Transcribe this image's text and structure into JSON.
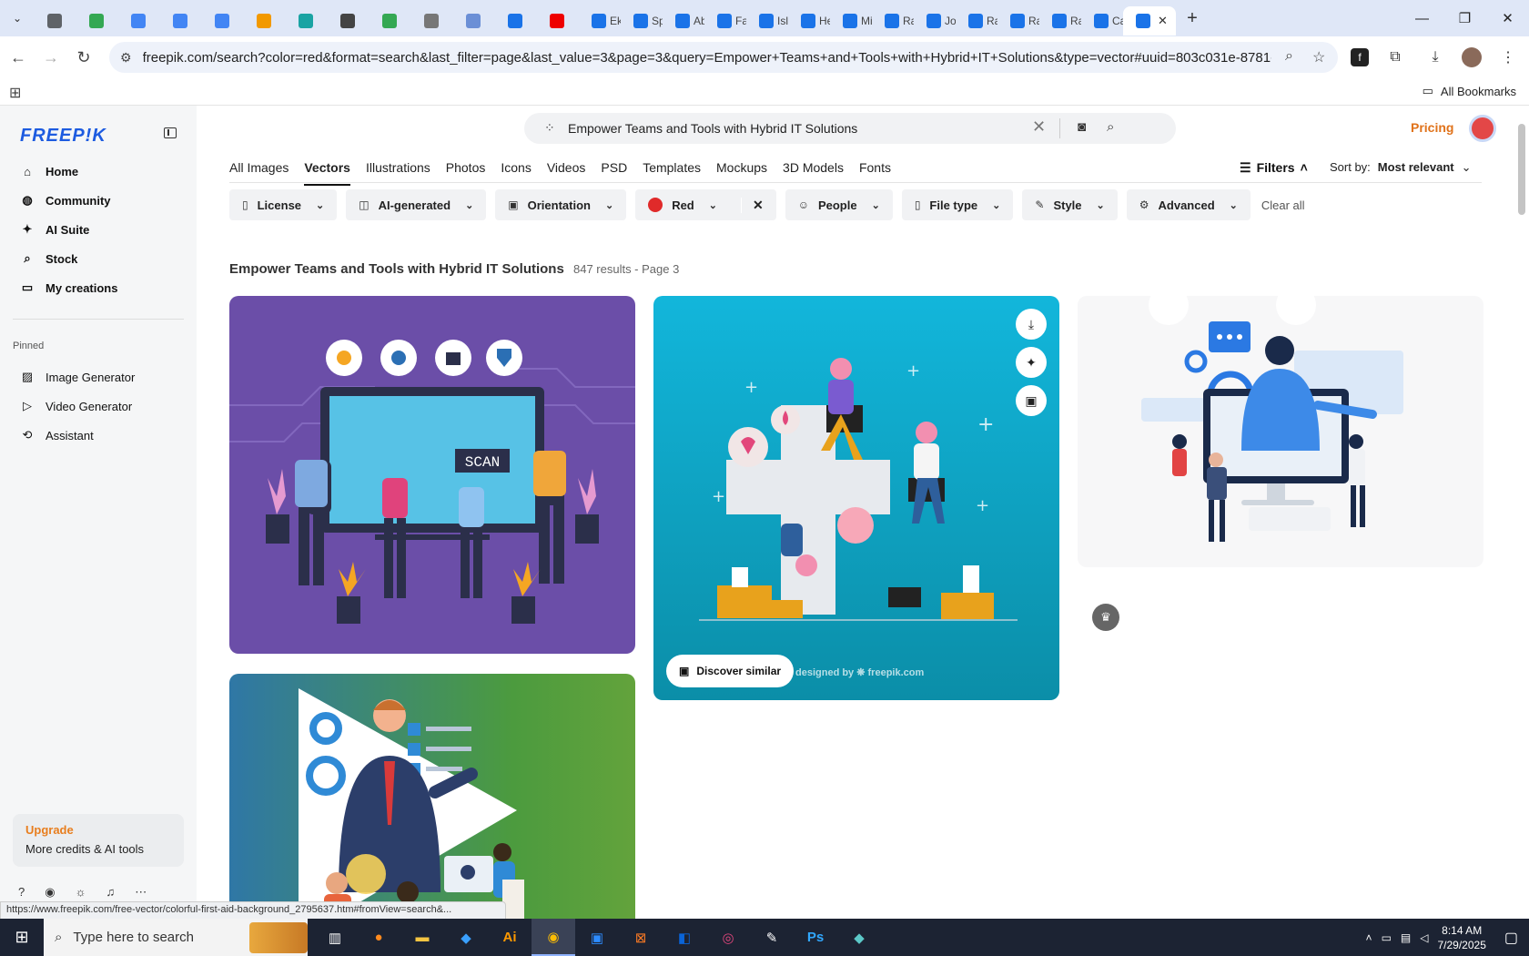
{
  "browser": {
    "tabs": [
      {
        "title": "",
        "color": "#5f6368"
      },
      {
        "title": "",
        "color": "#34a853"
      },
      {
        "title": "",
        "color": "#4285f4"
      },
      {
        "title": "",
        "color": "#4285f4"
      },
      {
        "title": "",
        "color": "#4285f4"
      },
      {
        "title": "",
        "color": "#f29900"
      },
      {
        "title": "",
        "color": "#1aa3a3"
      },
      {
        "title": "",
        "color": "#444"
      },
      {
        "title": "",
        "color": "#34a853"
      },
      {
        "title": "",
        "color": "#777"
      },
      {
        "title": "",
        "color": "#6b8fd6"
      },
      {
        "title": "",
        "color": "#1a73e8"
      },
      {
        "title": "",
        "color": "#e00"
      },
      {
        "title": "Ek",
        "color": "#1a73e8"
      },
      {
        "title": "Sp",
        "color": "#1a73e8"
      },
      {
        "title": "Ab",
        "color": "#1a73e8"
      },
      {
        "title": "Fa",
        "color": "#1a73e8"
      },
      {
        "title": "Isl",
        "color": "#1a73e8"
      },
      {
        "title": "He",
        "color": "#1a73e8"
      },
      {
        "title": "Mi",
        "color": "#1a73e8"
      },
      {
        "title": "Ra",
        "color": "#1a73e8"
      },
      {
        "title": "Jo",
        "color": "#1a73e8"
      },
      {
        "title": "Ra",
        "color": "#1a73e8"
      },
      {
        "title": "Ra",
        "color": "#1a73e8"
      },
      {
        "title": "Ra",
        "color": "#1a73e8"
      },
      {
        "title": "Ca",
        "color": "#1a73e8"
      }
    ],
    "active_tab": {
      "color": "#1a73e8"
    },
    "url": "freepik.com/search?color=red&format=search&last_filter=page&last_value=3&page=3&query=Empower+Teams+and+Tools+with+Hybrid+IT+Solutions&type=vector#uuid=803c031e-8781-4639-a...",
    "all_bookmarks": "All Bookmarks",
    "status_url": "https://www.freepik.com/free-vector/colorful-first-aid-background_2795637.htm#fromView=search&..."
  },
  "sidebar": {
    "logo": "FREEP!K",
    "nav": [
      {
        "label": "Home",
        "icon": "home-icon",
        "glyph": "⌂"
      },
      {
        "label": "Community",
        "icon": "globe-icon",
        "glyph": "◍"
      },
      {
        "label": "AI Suite",
        "icon": "sparkle-icon",
        "glyph": "✦"
      },
      {
        "label": "Stock",
        "icon": "search-icon",
        "glyph": "⌕"
      },
      {
        "label": "My creations",
        "icon": "folder-icon",
        "glyph": "▭"
      }
    ],
    "pinned_label": "Pinned",
    "pinned": [
      {
        "label": "Image Generator",
        "icon": "image-icon",
        "glyph": "▨"
      },
      {
        "label": "Video Generator",
        "icon": "video-icon",
        "glyph": "▷"
      },
      {
        "label": "Assistant",
        "icon": "assistant-icon",
        "glyph": "⟲"
      }
    ],
    "upgrade_title": "Upgrade",
    "upgrade_sub": "More credits & AI tools"
  },
  "search": {
    "query": "Empower Teams and Tools with Hybrid IT Solutions"
  },
  "header": {
    "pricing": "Pricing"
  },
  "categories": [
    "All Images",
    "Vectors",
    "Illustrations",
    "Photos",
    "Icons",
    "Videos",
    "PSD",
    "Templates",
    "Mockups",
    "3D Models",
    "Fonts"
  ],
  "filters_label": "Filters",
  "sort": {
    "label": "Sort by:",
    "value": "Most relevant"
  },
  "chips": [
    {
      "label": "License",
      "icon": "▯"
    },
    {
      "label": "AI-generated",
      "icon": "◫"
    },
    {
      "label": "Orientation",
      "icon": "▣"
    },
    {
      "label": "Red",
      "icon": ""
    },
    {
      "label": "People",
      "icon": "☺"
    },
    {
      "label": "File type",
      "icon": "▯"
    },
    {
      "label": "Style",
      "icon": "✎"
    },
    {
      "label": "Advanced",
      "icon": "⚙"
    }
  ],
  "clear_all": "Clear all",
  "results": {
    "title": "Empower Teams and Tools with Hybrid IT Solutions",
    "summary": "847 results - Page 3"
  },
  "card2": {
    "discover": "Discover similar",
    "designed_by": "designed by ❋ freepik.com"
  },
  "card1_scan_label": "SCAN",
  "taskbar": {
    "search_placeholder": "Type here to search",
    "time": "8:14 AM",
    "date": "7/29/2025"
  }
}
